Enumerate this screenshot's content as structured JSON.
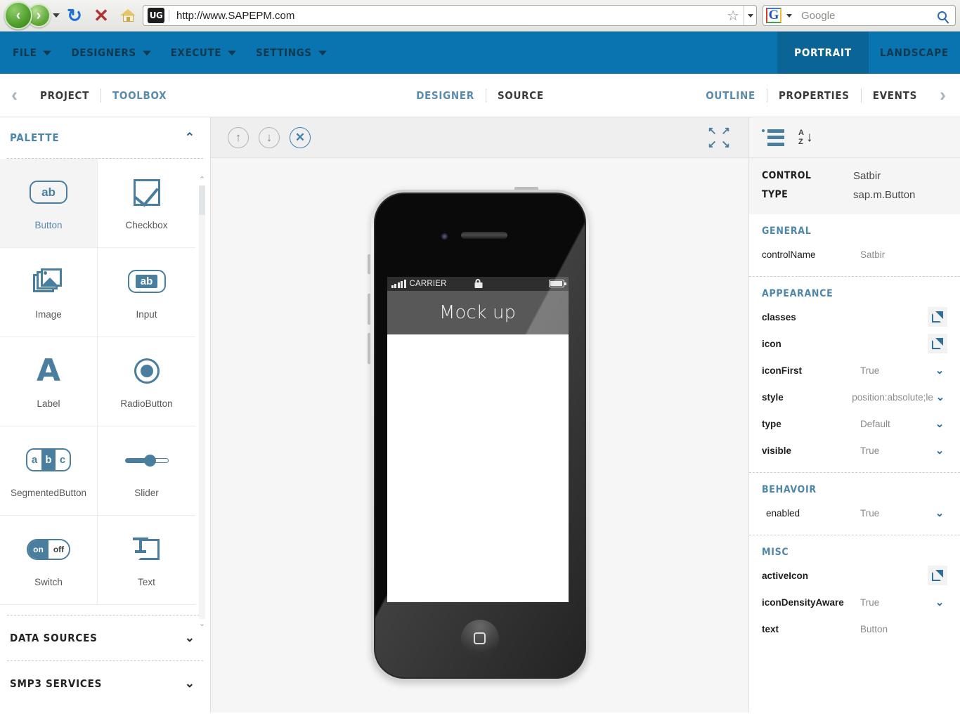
{
  "browser": {
    "back_icon": "back-arrow-icon",
    "forward_icon": "forward-arrow-icon",
    "reload_glyph": "↻",
    "stop_glyph": "✕",
    "url_badge": "UG",
    "url": "http://www.SAPEPM.com",
    "bookmark_glyph": "☆",
    "search_engine": "G",
    "search_placeholder": "Google"
  },
  "menubar": {
    "items": [
      {
        "label": "FILE"
      },
      {
        "label": "DESIGNERS"
      },
      {
        "label": "EXECUTE"
      },
      {
        "label": "SETTINGS"
      }
    ],
    "orientation": [
      {
        "label": "PORTRAIT",
        "active": true
      },
      {
        "label": "LANDSCAPE",
        "active": false
      }
    ]
  },
  "navrow": {
    "back_glyph": "‹",
    "forward_glyph": "›",
    "left": [
      {
        "label": "PROJECT",
        "active": false
      },
      {
        "label": "TOOLBOX",
        "active": true
      }
    ],
    "center": [
      {
        "label": "DESIGNER",
        "active": true
      },
      {
        "label": "SOURCE",
        "active": false
      }
    ],
    "right": [
      {
        "label": "OUTLINE",
        "active": true
      },
      {
        "label": "PROPERTIES",
        "active": false
      },
      {
        "label": "EVENTS",
        "active": false
      }
    ]
  },
  "palette": {
    "title": "PALETTE",
    "collapse_glyph": "⌃",
    "expand_glyph": "⌄",
    "items": [
      {
        "label": "Button",
        "icon": "button-icon",
        "selected": true
      },
      {
        "label": "Checkbox",
        "icon": "checkbox-icon",
        "selected": false
      },
      {
        "label": "Image",
        "icon": "image-icon",
        "selected": false
      },
      {
        "label": "Input",
        "icon": "input-icon",
        "selected": false
      },
      {
        "label": "Label",
        "icon": "label-icon",
        "selected": false
      },
      {
        "label": "RadioButton",
        "icon": "radiobutton-icon",
        "selected": false
      },
      {
        "label": "SegmentedButton",
        "icon": "segmentedbutton-icon",
        "selected": false
      },
      {
        "label": "Slider",
        "icon": "slider-icon",
        "selected": false
      },
      {
        "label": "Switch",
        "icon": "switch-icon",
        "selected": false
      },
      {
        "label": "Text",
        "icon": "text-icon",
        "selected": false
      }
    ],
    "icon_text": {
      "button": "ab",
      "input": "ab",
      "label": "A",
      "seg_a": "a",
      "seg_b": "b",
      "seg_c": "c",
      "switch_on": "on",
      "switch_off": "off"
    },
    "sections": [
      {
        "label": "DATA SOURCES"
      },
      {
        "label": "SMP3 SERVICES"
      }
    ],
    "scroll_up_glyph": "⌃",
    "scroll_down_glyph": "⌄"
  },
  "canvas": {
    "toolbar": {
      "move_up": "↑",
      "move_down": "↓",
      "delete": "✕",
      "expand_tl": "↖",
      "expand_tr": "↗",
      "expand_bl": "↙",
      "expand_br": "↘"
    },
    "device": {
      "carrier": "CARRIER",
      "app_title": "Mock up"
    }
  },
  "properties": {
    "toolbar": {
      "group_icon": "group-list-icon",
      "sort_icon": "sort-az-icon",
      "sort_a": "A",
      "sort_z": "Z",
      "sort_arrow": "↓"
    },
    "header": [
      {
        "key": "CONTROL",
        "value": "Satbir"
      },
      {
        "key": "TYPE",
        "value": "sap.m.Button"
      }
    ],
    "groups": [
      {
        "title": "GENERAL",
        "rows": [
          {
            "key": "controlName",
            "value": "Satbir",
            "control": "none"
          }
        ]
      },
      {
        "title": "APPEARANCE",
        "rows": [
          {
            "key": "classes",
            "value": "",
            "control": "external"
          },
          {
            "key": "icon",
            "value": "",
            "control": "external"
          },
          {
            "key": "iconFirst",
            "value": "True",
            "control": "dropdown"
          },
          {
            "key": "style",
            "value": "position:absolute;le",
            "control": "dropdown"
          },
          {
            "key": "type",
            "value": "Default",
            "control": "dropdown"
          },
          {
            "key": "visible",
            "value": "True",
            "control": "dropdown"
          }
        ]
      },
      {
        "title": "BEHAVOIR",
        "rows": [
          {
            "key": "enabled",
            "value": "True",
            "control": "dropdown"
          }
        ]
      },
      {
        "title": "MISC",
        "rows": [
          {
            "key": "activeIcon",
            "value": "",
            "control": "external"
          },
          {
            "key": "iconDensityAware",
            "value": "True",
            "control": "dropdown"
          },
          {
            "key": "text",
            "value": "Button",
            "control": "none"
          }
        ]
      }
    ],
    "dropdown_glyph": "⌄"
  },
  "colors": {
    "brand_blue": "#0a74b0",
    "accent_blue": "#4a7e9e",
    "link_blue": "#5b8bab"
  }
}
